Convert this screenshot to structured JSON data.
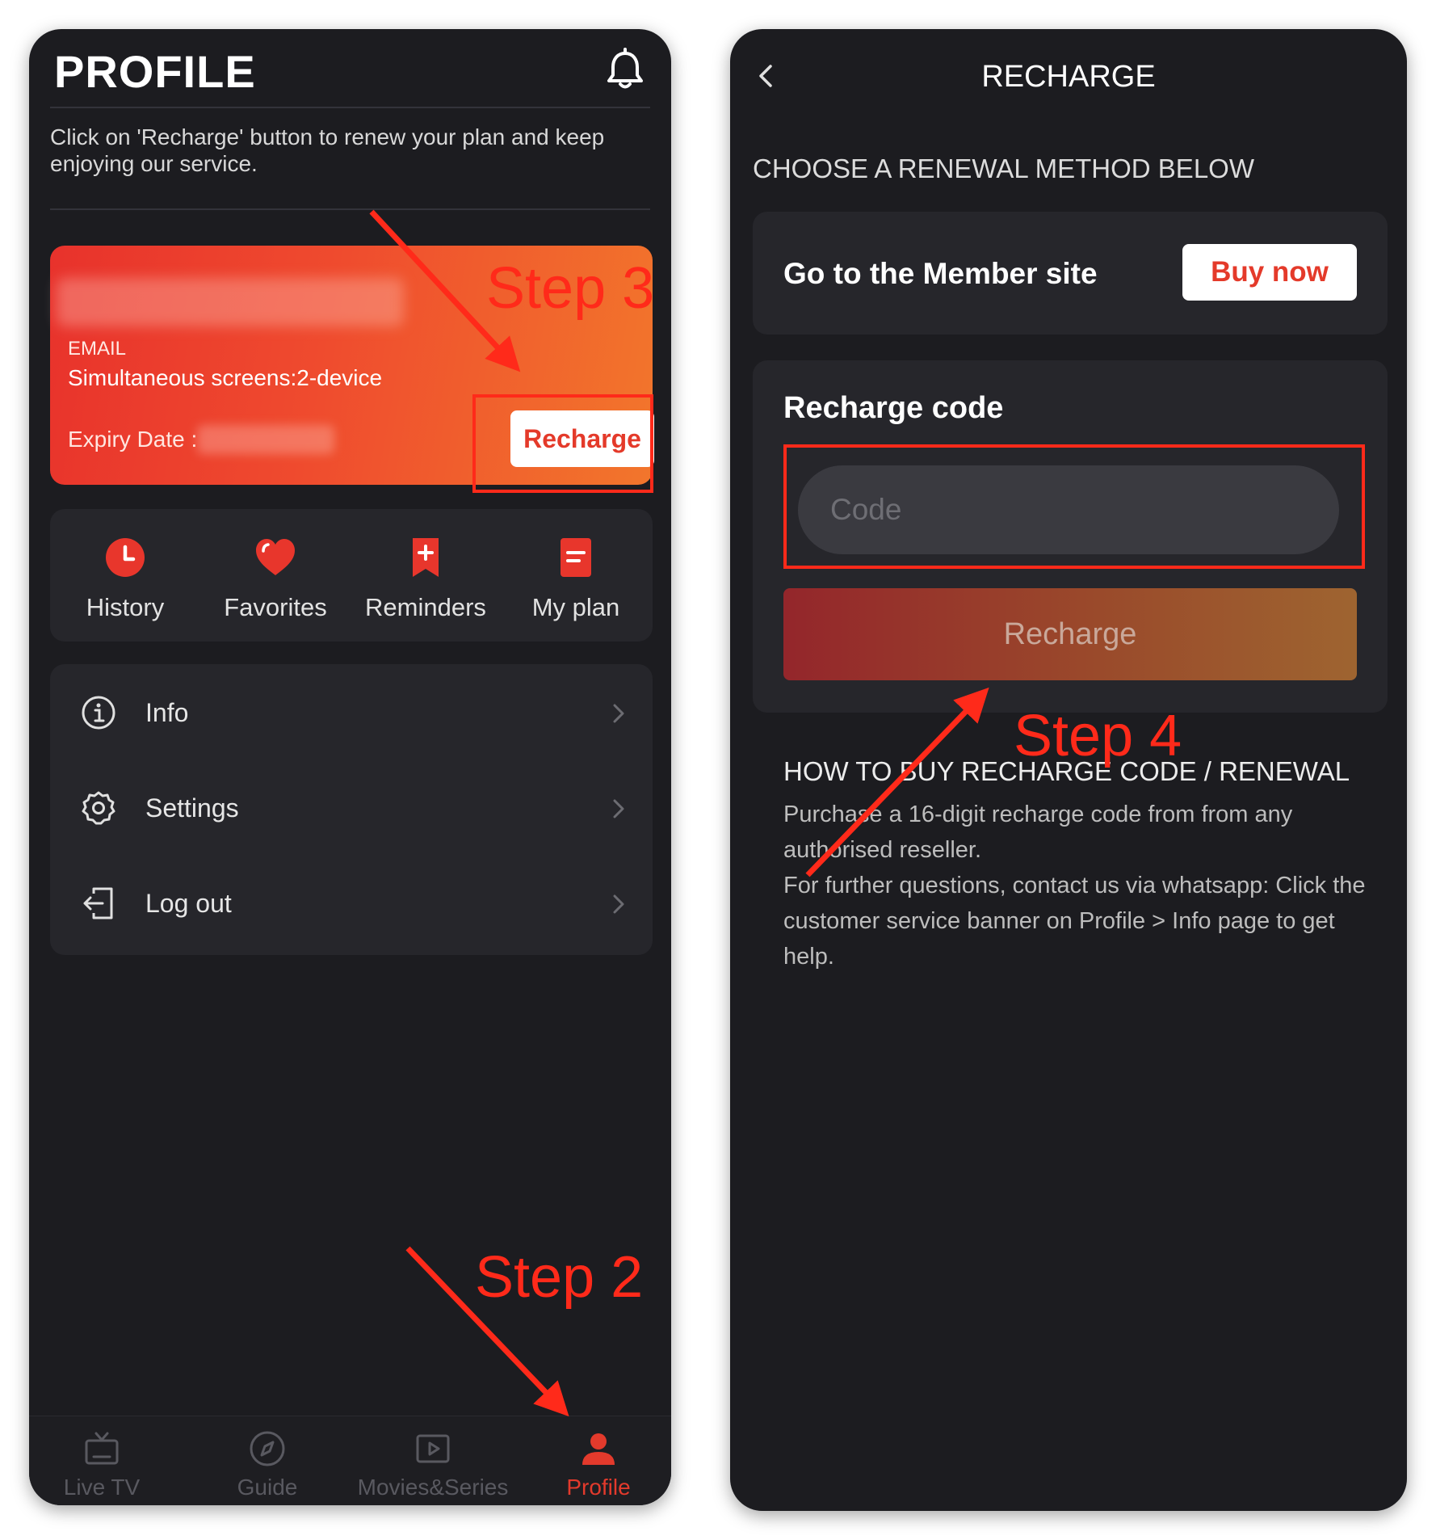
{
  "profile": {
    "title": "PROFILE",
    "notice": "Click on 'Recharge' button to renew your plan and keep enjoying our service.",
    "card": {
      "email_label": "EMAIL",
      "screens": "Simultaneous screens:2-device",
      "expiry_label": "Expiry Date :",
      "recharge_label": "Recharge"
    },
    "quick_actions": [
      {
        "label": "History",
        "icon": "clock-icon"
      },
      {
        "label": "Favorites",
        "icon": "heart-icon"
      },
      {
        "label": "Reminders",
        "icon": "bookmark-plus-icon"
      },
      {
        "label": "My plan",
        "icon": "document-icon"
      }
    ],
    "menu": [
      {
        "label": "Info",
        "icon": "info-icon"
      },
      {
        "label": "Settings",
        "icon": "gear-icon"
      },
      {
        "label": "Log out",
        "icon": "logout-icon"
      }
    ],
    "tabs": [
      {
        "label": "Live TV",
        "icon": "tv-icon"
      },
      {
        "label": "Guide",
        "icon": "compass-icon"
      },
      {
        "label": "Movies&Series",
        "icon": "play-icon"
      },
      {
        "label": "Profile",
        "icon": "user-icon",
        "active": true
      }
    ]
  },
  "recharge": {
    "title": "RECHARGE",
    "heading": "CHOOSE A RENEWAL METHOD BELOW",
    "member_label": "Go to the Member site",
    "buy_label": "Buy now",
    "code_label": "Recharge code",
    "code_placeholder": "Code",
    "recharge_button": "Recharge",
    "howto_title": "HOW TO BUY RECHARGE CODE / RENEWAL",
    "howto_line1": "Purchase a 16-digit recharge code from from any authorised reseller.",
    "howto_line2": "For further questions, contact us via whatsapp: Click the customer service banner on Profile > Info page to get help."
  },
  "annotations": {
    "step2": "Step 2",
    "step3": "Step 3",
    "step4": "Step 4"
  },
  "colors": {
    "accent_red": "#e33a2c",
    "annotation_red": "#ff2a1a",
    "background": "#1c1c20",
    "panel": "#26262b"
  }
}
